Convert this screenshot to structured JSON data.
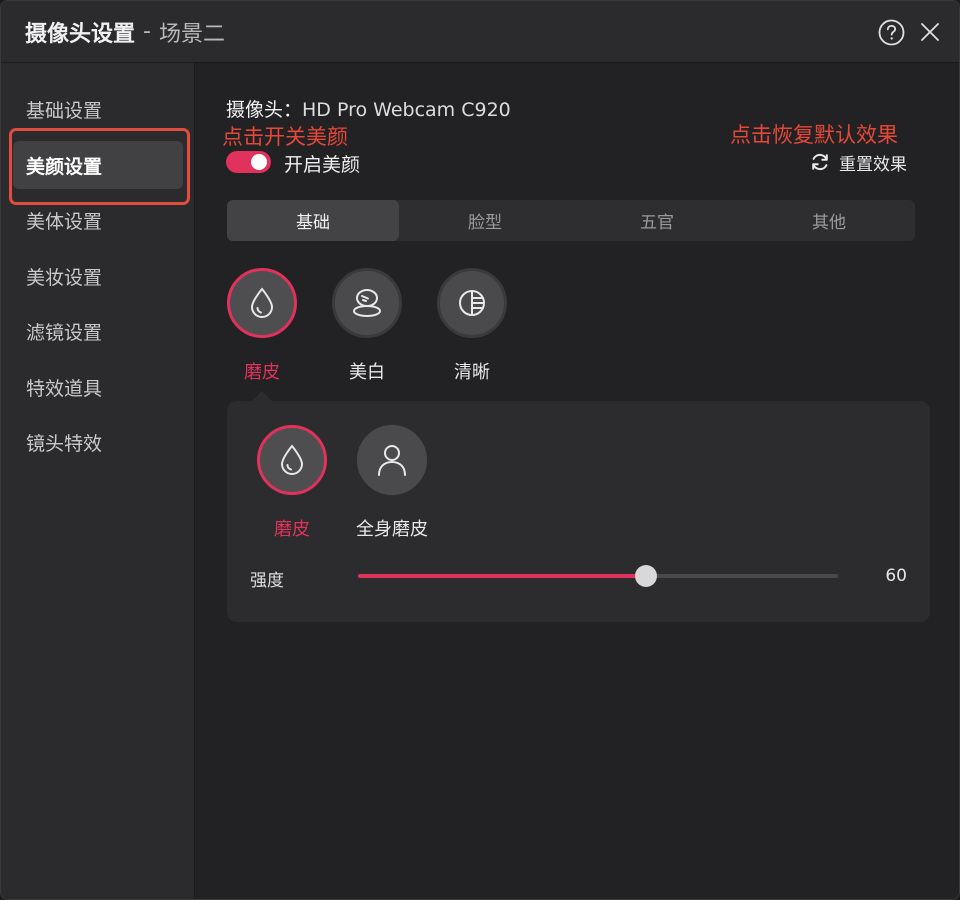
{
  "window": {
    "title": "摄像头设置",
    "separator": "-",
    "scene": "场景二"
  },
  "sidebar": {
    "items": [
      {
        "label": "基础设置"
      },
      {
        "label": "美颜设置",
        "active": true
      },
      {
        "label": "美体设置"
      },
      {
        "label": "美妆设置"
      },
      {
        "label": "滤镜设置"
      },
      {
        "label": "特效道具"
      },
      {
        "label": "镜头特效"
      }
    ]
  },
  "main": {
    "camera_label": "摄像头：",
    "camera_name": "HD Pro Webcam C920",
    "annotation_left": "点击开关美颜",
    "annotation_right": "点击恢复默认效果",
    "toggle_label": "开启美颜",
    "toggle_on": true,
    "reset_label": "重置效果",
    "tabs": [
      {
        "label": "基础",
        "active": true
      },
      {
        "label": "脸型"
      },
      {
        "label": "五官"
      },
      {
        "label": "其他"
      }
    ],
    "features": [
      {
        "label": "磨皮",
        "icon": "droplet-icon",
        "active": true
      },
      {
        "label": "美白",
        "icon": "whitening-icon"
      },
      {
        "label": "清晰",
        "icon": "clarity-icon"
      }
    ],
    "sub_options": [
      {
        "label": "磨皮",
        "icon": "droplet-icon",
        "active": true
      },
      {
        "label": "全身磨皮",
        "icon": "person-icon"
      }
    ],
    "slider": {
      "label": "强度",
      "value": 60,
      "value_text": "60",
      "max": 100
    }
  },
  "colors": {
    "accent": "#e0325c",
    "annotation": "#e54838",
    "background": "#232325"
  }
}
